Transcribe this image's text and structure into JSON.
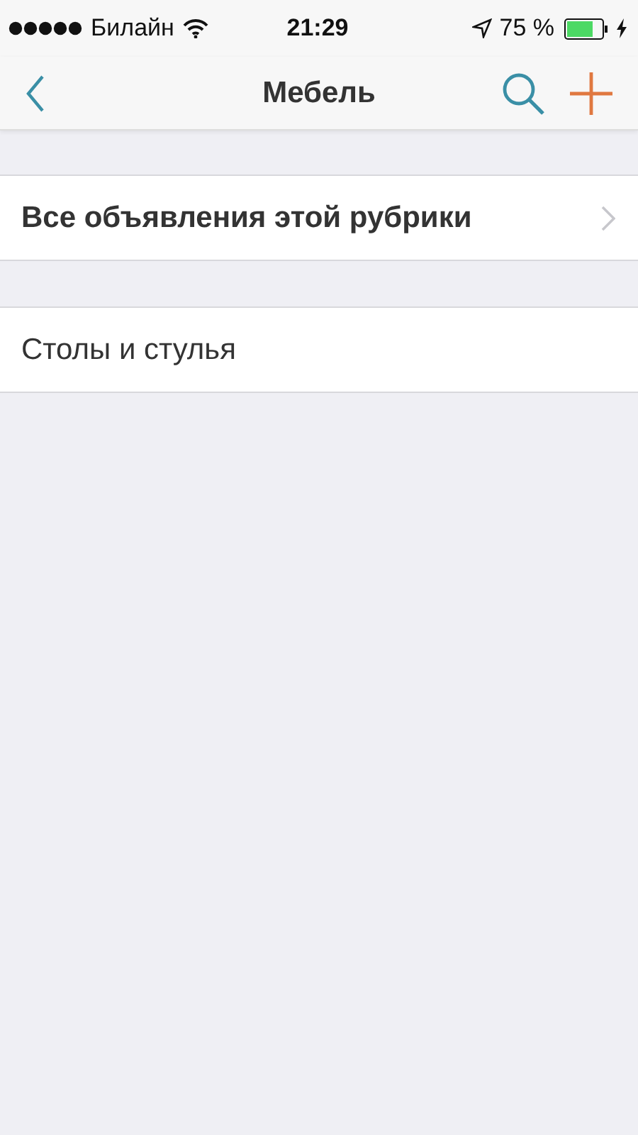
{
  "status_bar": {
    "carrier": "Билайн",
    "time": "21:29",
    "battery": "75 %"
  },
  "nav_bar": {
    "title": "Мебель"
  },
  "sections": [
    {
      "rows": [
        {
          "kind": "all",
          "label": "Все объявления этой рубрики"
        }
      ]
    },
    {
      "rows": [
        {
          "kind": "category",
          "label": "Столы и стулья"
        }
      ]
    }
  ]
}
